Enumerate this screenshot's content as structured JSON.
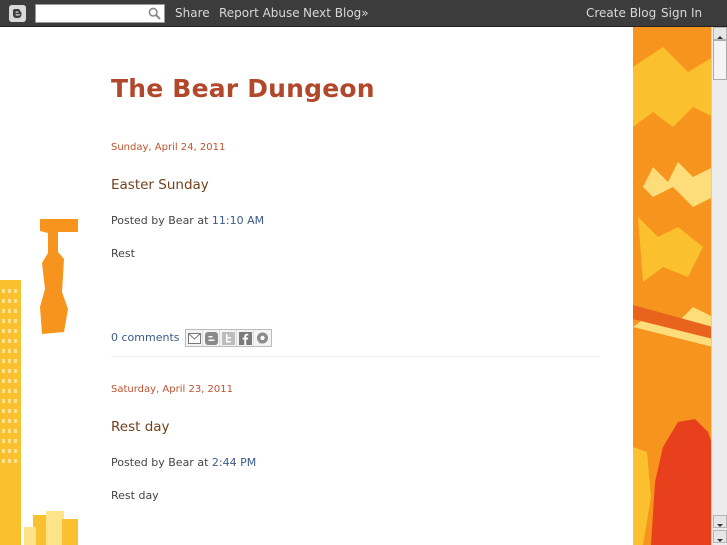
{
  "navbar": {
    "search": {
      "value": "",
      "placeholder": ""
    },
    "share_label": "Share",
    "report_label": "Report Abuse",
    "next_label": "Next Blog»",
    "create_label": "Create Blog",
    "signin_label": "Sign In"
  },
  "blog": {
    "title": "The Bear Dungeon"
  },
  "posts": [
    {
      "date": "Sunday, April 24, 2011",
      "title": "Easter Sunday",
      "posted_by": "Posted by Bear at ",
      "time": "11:10 AM",
      "body": "Rest",
      "comments": "0 comments"
    },
    {
      "date": "Saturday, April 23, 2011",
      "title": "Rest day",
      "posted_by": "Posted by Bear at ",
      "time": "2:44 PM",
      "body": "Rest day"
    }
  ],
  "share_icons": [
    "email-icon",
    "blogthis-icon",
    "twitter-icon",
    "facebook-icon",
    "buzz-icon"
  ],
  "colors": {
    "navbar": "#3c3c3c",
    "title": "#b2482b",
    "date": "#c0522f",
    "post_title": "#73401e",
    "link": "#3b5b8a",
    "deco_orange": "#f7941d",
    "deco_yellow": "#fbc02d",
    "deco_red": "#e8401c"
  }
}
